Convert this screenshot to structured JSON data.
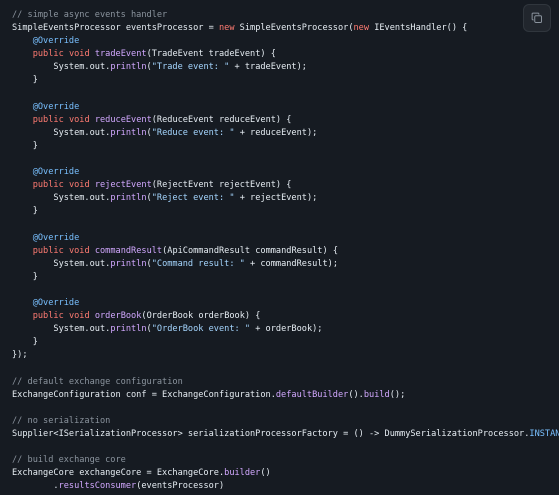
{
  "copy_button": {
    "icon": "copy-icon"
  },
  "colors": {
    "background": "#161b22",
    "comment": "#8b949e",
    "keyword": "#ff7b72",
    "plain": "#e6edf3",
    "function": "#d2a8ff",
    "string": "#a5d6ff",
    "annotation": "#79c0ff"
  },
  "code": {
    "lines": [
      [
        {
          "c": "c",
          "v": "// simple async events handler"
        }
      ],
      [
        {
          "c": "t",
          "v": "SimpleEventsProcessor eventsProcessor = "
        },
        {
          "c": "k",
          "v": "new"
        },
        {
          "c": "t",
          "v": " SimpleEventsProcessor("
        },
        {
          "c": "k",
          "v": "new"
        },
        {
          "c": "t",
          "v": " IEventsHandler() {"
        }
      ],
      [
        {
          "c": "t",
          "v": "    "
        },
        {
          "c": "a",
          "v": "@Override"
        }
      ],
      [
        {
          "c": "t",
          "v": "    "
        },
        {
          "c": "k",
          "v": "public"
        },
        {
          "c": "t",
          "v": " "
        },
        {
          "c": "k",
          "v": "void"
        },
        {
          "c": "t",
          "v": " "
        },
        {
          "c": "f",
          "v": "tradeEvent"
        },
        {
          "c": "t",
          "v": "(TradeEvent tradeEvent) {"
        }
      ],
      [
        {
          "c": "t",
          "v": "        System.out."
        },
        {
          "c": "f",
          "v": "println"
        },
        {
          "c": "t",
          "v": "("
        },
        {
          "c": "s",
          "v": "\"Trade event: \""
        },
        {
          "c": "t",
          "v": " + tradeEvent);"
        }
      ],
      [
        {
          "c": "t",
          "v": "    }"
        }
      ],
      [
        {
          "c": "t",
          "v": ""
        }
      ],
      [
        {
          "c": "t",
          "v": "    "
        },
        {
          "c": "a",
          "v": "@Override"
        }
      ],
      [
        {
          "c": "t",
          "v": "    "
        },
        {
          "c": "k",
          "v": "public"
        },
        {
          "c": "t",
          "v": " "
        },
        {
          "c": "k",
          "v": "void"
        },
        {
          "c": "t",
          "v": " "
        },
        {
          "c": "f",
          "v": "reduceEvent"
        },
        {
          "c": "t",
          "v": "(ReduceEvent reduceEvent) {"
        }
      ],
      [
        {
          "c": "t",
          "v": "        System.out."
        },
        {
          "c": "f",
          "v": "println"
        },
        {
          "c": "t",
          "v": "("
        },
        {
          "c": "s",
          "v": "\"Reduce event: \""
        },
        {
          "c": "t",
          "v": " + reduceEvent);"
        }
      ],
      [
        {
          "c": "t",
          "v": "    }"
        }
      ],
      [
        {
          "c": "t",
          "v": ""
        }
      ],
      [
        {
          "c": "t",
          "v": "    "
        },
        {
          "c": "a",
          "v": "@Override"
        }
      ],
      [
        {
          "c": "t",
          "v": "    "
        },
        {
          "c": "k",
          "v": "public"
        },
        {
          "c": "t",
          "v": " "
        },
        {
          "c": "k",
          "v": "void"
        },
        {
          "c": "t",
          "v": " "
        },
        {
          "c": "f",
          "v": "rejectEvent"
        },
        {
          "c": "t",
          "v": "(RejectEvent rejectEvent) {"
        }
      ],
      [
        {
          "c": "t",
          "v": "        System.out."
        },
        {
          "c": "f",
          "v": "println"
        },
        {
          "c": "t",
          "v": "("
        },
        {
          "c": "s",
          "v": "\"Reject event: \""
        },
        {
          "c": "t",
          "v": " + rejectEvent);"
        }
      ],
      [
        {
          "c": "t",
          "v": "    }"
        }
      ],
      [
        {
          "c": "t",
          "v": ""
        }
      ],
      [
        {
          "c": "t",
          "v": "    "
        },
        {
          "c": "a",
          "v": "@Override"
        }
      ],
      [
        {
          "c": "t",
          "v": "    "
        },
        {
          "c": "k",
          "v": "public"
        },
        {
          "c": "t",
          "v": " "
        },
        {
          "c": "k",
          "v": "void"
        },
        {
          "c": "t",
          "v": " "
        },
        {
          "c": "f",
          "v": "commandResult"
        },
        {
          "c": "t",
          "v": "(ApiCommandResult commandResult) {"
        }
      ],
      [
        {
          "c": "t",
          "v": "        System.out."
        },
        {
          "c": "f",
          "v": "println"
        },
        {
          "c": "t",
          "v": "("
        },
        {
          "c": "s",
          "v": "\"Command result: \""
        },
        {
          "c": "t",
          "v": " + commandResult);"
        }
      ],
      [
        {
          "c": "t",
          "v": "    }"
        }
      ],
      [
        {
          "c": "t",
          "v": ""
        }
      ],
      [
        {
          "c": "t",
          "v": "    "
        },
        {
          "c": "a",
          "v": "@Override"
        }
      ],
      [
        {
          "c": "t",
          "v": "    "
        },
        {
          "c": "k",
          "v": "public"
        },
        {
          "c": "t",
          "v": " "
        },
        {
          "c": "k",
          "v": "void"
        },
        {
          "c": "t",
          "v": " "
        },
        {
          "c": "f",
          "v": "orderBook"
        },
        {
          "c": "t",
          "v": "(OrderBook orderBook) {"
        }
      ],
      [
        {
          "c": "t",
          "v": "        System.out."
        },
        {
          "c": "f",
          "v": "println"
        },
        {
          "c": "t",
          "v": "("
        },
        {
          "c": "s",
          "v": "\"OrderBook event: \""
        },
        {
          "c": "t",
          "v": " + orderBook);"
        }
      ],
      [
        {
          "c": "t",
          "v": "    }"
        }
      ],
      [
        {
          "c": "t",
          "v": "});"
        }
      ],
      [
        {
          "c": "t",
          "v": ""
        }
      ],
      [
        {
          "c": "c",
          "v": "// default exchange configuration"
        }
      ],
      [
        {
          "c": "t",
          "v": "ExchangeConfiguration conf = ExchangeConfiguration."
        },
        {
          "c": "f",
          "v": "defaultBuilder"
        },
        {
          "c": "t",
          "v": "()."
        },
        {
          "c": "f",
          "v": "build"
        },
        {
          "c": "t",
          "v": "();"
        }
      ],
      [
        {
          "c": "t",
          "v": ""
        }
      ],
      [
        {
          "c": "c",
          "v": "// no serialization"
        }
      ],
      [
        {
          "c": "t",
          "v": "Supplier<ISerializationProcessor> serializationProcessorFactory = () -> DummySerializationProcessor."
        },
        {
          "c": "a",
          "v": "INSTANCE"
        },
        {
          "c": "t",
          "v": ";"
        }
      ],
      [
        {
          "c": "t",
          "v": ""
        }
      ],
      [
        {
          "c": "c",
          "v": "// build exchange core"
        }
      ],
      [
        {
          "c": "t",
          "v": "ExchangeCore exchangeCore = ExchangeCore."
        },
        {
          "c": "f",
          "v": "builder"
        },
        {
          "c": "t",
          "v": "()"
        }
      ],
      [
        {
          "c": "t",
          "v": "        ."
        },
        {
          "c": "f",
          "v": "resultsConsumer"
        },
        {
          "c": "t",
          "v": "(eventsProcessor)"
        }
      ]
    ]
  }
}
